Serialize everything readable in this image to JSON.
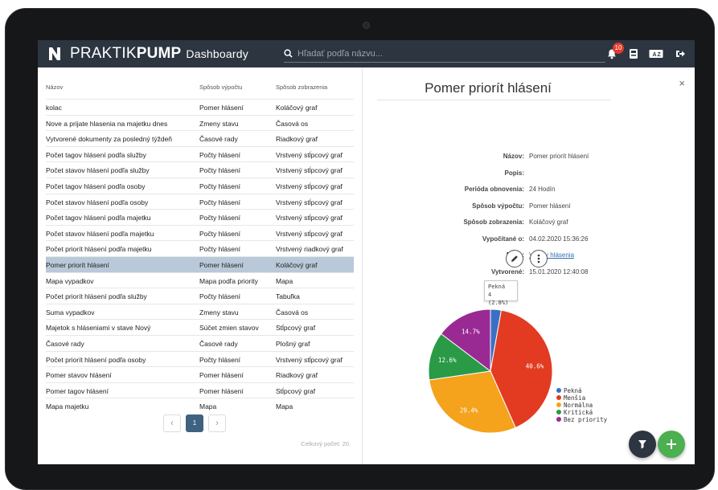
{
  "app": {
    "brand_light": "PRAKTIK",
    "brand_bold": "PUMP",
    "section": "Dashboardy",
    "search_placeholder": "Hľadať podľa názvu...",
    "notification_count": "10"
  },
  "table": {
    "headers": [
      "Názov",
      "Spôsob výpočtu",
      "Spôsob zobrazenia"
    ],
    "rows": [
      [
        "kolac",
        "Pomer hlásení",
        "Koláčový graf"
      ],
      [
        "Nove a prijate hlasenia na majetku dnes",
        "Zmeny stavu",
        "Časová os"
      ],
      [
        "Vytvorené dokumenty za posledný týždeň",
        "Časové rady",
        "Riadkový graf"
      ],
      [
        "Počet tagov hlásení podľa služby",
        "Počty hlásení",
        "Vrstvený stĺpcový graf"
      ],
      [
        "Počet stavov hlásení podľa služby",
        "Počty hlásení",
        "Vrstvený stĺpcový graf"
      ],
      [
        "Počet tagov hlásení podľa osoby",
        "Počty hlásení",
        "Vrstvený stĺpcový graf"
      ],
      [
        "Počet stavov hlásení podľa osoby",
        "Počty hlásení",
        "Vrstvený stĺpcový graf"
      ],
      [
        "Počet tagov hlásení podľa majetku",
        "Počty hlásení",
        "Vrstvený stĺpcový graf"
      ],
      [
        "Počet stavov hlásení podľa majetku",
        "Počty hlásení",
        "Vrstvený stĺpcový graf"
      ],
      [
        "Počet priorít hlásení podľa majetku",
        "Počty hlásení",
        "Vrstvený riadkový graf"
      ],
      [
        "Pomer priorít hlásení",
        "Pomer hlásení",
        "Koláčový graf"
      ],
      [
        "Mapa vypadkov",
        "Mapa podľa priority",
        "Mapa"
      ],
      [
        "Počet priorít hlásení podľa služby",
        "Počty hlásení",
        "Tabuľka"
      ],
      [
        "Suma vypadkov",
        "Zmeny stavu",
        "Časová os"
      ],
      [
        "Majetok s hláseniami v stave Nový",
        "Súčet zmien stavov",
        "Stĺpcový graf"
      ],
      [
        "Časové rady",
        "Časové rady",
        "Plošný graf"
      ],
      [
        "Počet priorít hlásení podľa osoby",
        "Počty hlásení",
        "Vrstvený stĺpcový graf"
      ],
      [
        "Pomer stavov hlásení",
        "Pomer hlásení",
        "Riadkový graf"
      ],
      [
        "Pomer tagov hlásení",
        "Pomer hlásení",
        "Stĺpcový graf"
      ],
      [
        "Mapa majetku",
        "Mapa",
        "Mapa"
      ]
    ],
    "selected_index": 10,
    "page": "1",
    "prev": "‹",
    "next": "›",
    "total": "Celkový počet: 20."
  },
  "detail": {
    "title": "Pomer priorít hlásení",
    "close": "×",
    "fields": [
      {
        "label": "Názov:",
        "value": "Pomer priorít hlásení",
        "link": false
      },
      {
        "label": "Popis:",
        "value": "",
        "link": false
      },
      {
        "label": "Perióda obnovenia:",
        "value": "24 Hodín",
        "link": false
      },
      {
        "label": "Spôsob výpočtu:",
        "value": "Pomer hlásení",
        "link": false
      },
      {
        "label": "Spôsob zobrazenia:",
        "value": "Koláčový graf",
        "link": false
      },
      {
        "label": "Vypočítané o:",
        "value": "04.02.2020 15:36:26",
        "link": false
      },
      {
        "label": "Filter:",
        "value": "Všetky hlásenia",
        "link": true
      },
      {
        "label": "Vytvorené:",
        "value": "15.01.2020 12:40:08",
        "link": false
      }
    ],
    "tooltip": {
      "line1": "Pekná",
      "line2": "4 (2.8%)"
    }
  },
  "chart_data": {
    "type": "pie",
    "labels": [
      "Pekná",
      "Menšia",
      "Normálna",
      "Kritická",
      "Bez priority"
    ],
    "values": [
      2.8,
      40.6,
      29.4,
      12.6,
      14.7
    ],
    "value_labels": [
      "",
      "40.6%",
      "29.4%",
      "12.6%",
      "14.7%"
    ],
    "colors": [
      "#3a6fc4",
      "#e23b22",
      "#f5a21d",
      "#2a9a47",
      "#9a2a93"
    ],
    "legend_position": "right"
  },
  "colors": {
    "topbar": "#2c3540",
    "selected_row": "#b9c9d9",
    "fab_filter": "#2c3540",
    "fab_add": "#4caf50"
  }
}
